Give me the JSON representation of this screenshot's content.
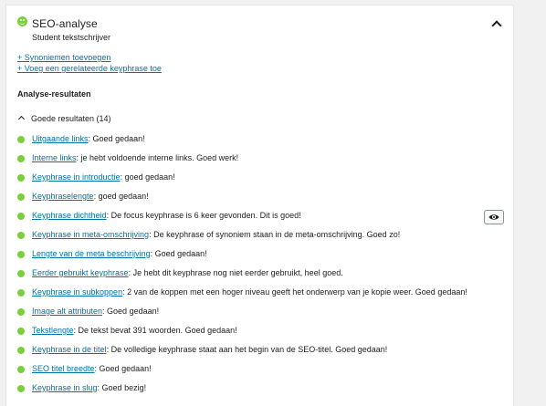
{
  "header": {
    "title": "SEO-analyse",
    "subtitle": "Student tekstschrijver",
    "status_icon": "smiley-good-icon",
    "collapse_icon": "chevron-up-icon"
  },
  "links": {
    "synonyms": "+ Synoniemen toevoegen",
    "related_keyphrase": "+ Voeg een gerelateerde keyphrase toe"
  },
  "analysis": {
    "title": "Analyse-resultaten",
    "group_label": "Goede resultaten (14)",
    "results": [
      {
        "link": "Uitgaande links",
        "text": ": Goed gedaan!"
      },
      {
        "link": "Interne links",
        "text": ": je hebt voldoende interne links. Goed werk!"
      },
      {
        "link": "Keyphrase in introductie",
        "text": ": goed gedaan!"
      },
      {
        "link": "Keyphraselengte",
        "text": ": goed gedaan!"
      },
      {
        "link": "Keyphrase dichtheid",
        "text": ": De focus keyphrase is 6 keer gevonden. Dit is goed!"
      },
      {
        "link": "Keyphrase in meta-omschrijving",
        "text": ": De keyphrase of synoniem staan in de meta-omschrijving. Goed zo!"
      },
      {
        "link": "Lengte van de meta beschrijving",
        "text": ": Goed gedaan!"
      },
      {
        "link": "Eerder gebruikt keyphrase",
        "text": ": Je hebt dit keyphrase nog niet eerder gebruikt, heel goed."
      },
      {
        "link": "Keyphrase in subkoppen",
        "text": ": 2 van de koppen met een hoger niveau geeft het onderwerp van je kopie weer. Goed gedaan!"
      },
      {
        "link": "Image alt attributen",
        "text": ": Goed gedaan!"
      },
      {
        "link": "Tekstlengte",
        "text": ": De tekst bevat 391 woorden. Goed gedaan!"
      },
      {
        "link": "Keyphrase in de titel",
        "text": ": De volledige keyphrase staat aan het begin van de SEO-titel. Goed gedaan!"
      },
      {
        "link": "SEO titel breedte",
        "text": ": Goed gedaan!"
      },
      {
        "link": "Keyphrase in slug",
        "text": ": Goed bezig!"
      }
    ]
  },
  "colors": {
    "good": "#7ad03a",
    "link": "#0073aa",
    "text": "#1e1e1e"
  },
  "icons": {
    "highlight": "eye-icon"
  }
}
